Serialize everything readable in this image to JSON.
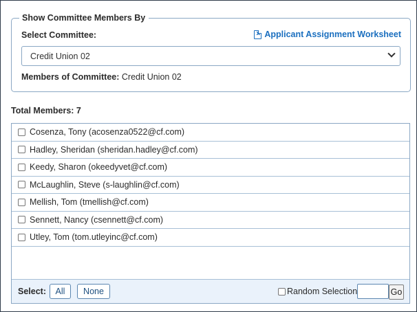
{
  "committee_section": {
    "legend": "Show Committee Members By",
    "select_label": "Select Committee:",
    "worksheet_link": "Applicant Assignment Worksheet",
    "worksheet_icon": "excel-icon",
    "selected_committee": "Credit Union 02",
    "members_of_label": "Members of Committee:",
    "members_of_value": "Credit Union 02"
  },
  "totals": {
    "label": "Total Members: 7"
  },
  "members": [
    {
      "label": "Cosenza, Tony (acosenza0522@cf.com)",
      "checked": false
    },
    {
      "label": "Hadley, Sheridan (sheridan.hadley@cf.com)",
      "checked": false
    },
    {
      "label": "Keedy, Sharon (okeedyvet@cf.com)",
      "checked": false
    },
    {
      "label": "McLaughlin, Steve (s-laughlin@cf.com)",
      "checked": false
    },
    {
      "label": "Mellish, Tom (tmellish@cf.com)",
      "checked": false
    },
    {
      "label": "Sennett, Nancy (csennett@cf.com)",
      "checked": false
    },
    {
      "label": "Utley, Tom (tom.utleyinc@cf.com)",
      "checked": false
    }
  ],
  "footer": {
    "select_label": "Select:",
    "all_button": "All",
    "none_button": "None",
    "random_label": "Random Selection",
    "random_value": "",
    "go_button": "Go"
  },
  "colors": {
    "link": "#1b6fbf",
    "border": "#8aa7c4",
    "footer_bg": "#eaf2fb"
  }
}
